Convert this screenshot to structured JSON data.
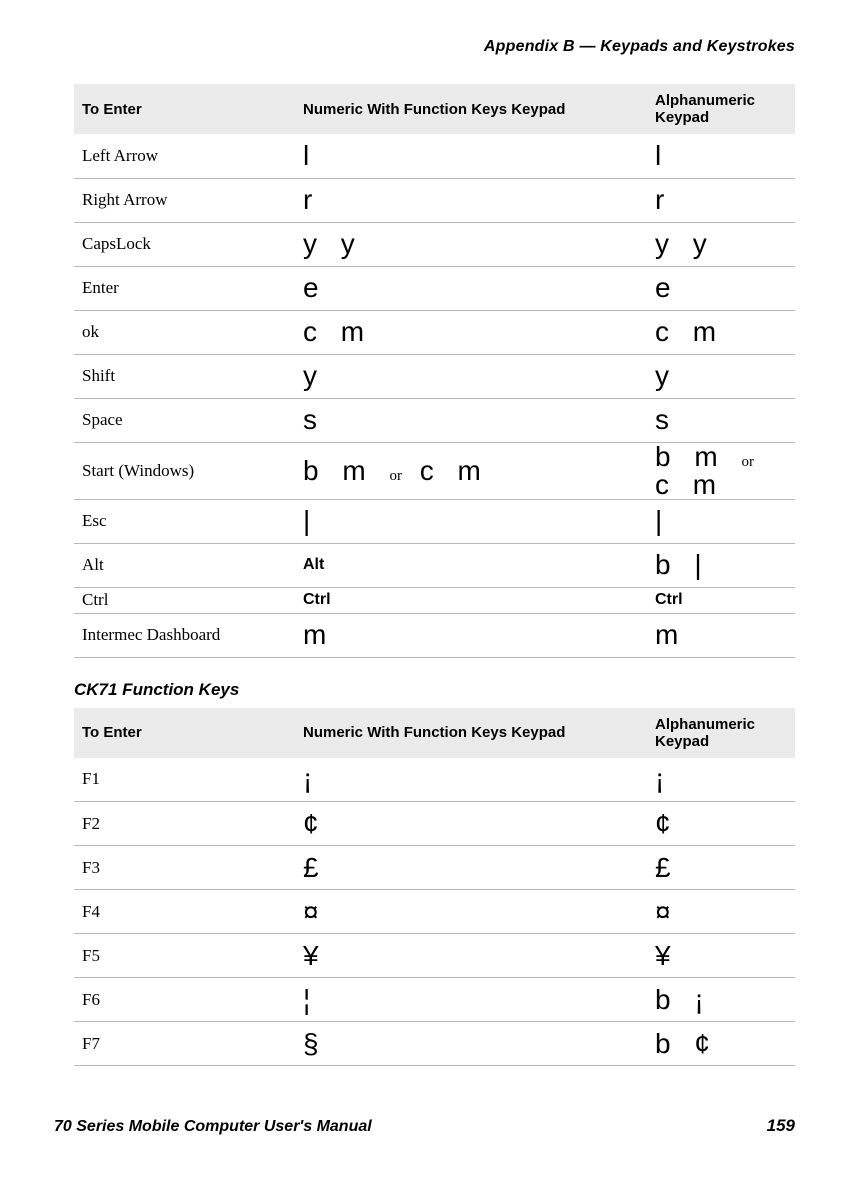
{
  "running_head": "Appendix B — Keypads and Keystrokes",
  "table1": {
    "headers": [
      "To Enter",
      "Numeric With Function Keys Keypad",
      "Alphanumeric Keypad"
    ],
    "rows": [
      {
        "label": "Left Arrow",
        "num": "l",
        "alpha": "l"
      },
      {
        "label": "Right Arrow",
        "num": "r",
        "alpha": "r"
      },
      {
        "label": "CapsLock",
        "num": "y y",
        "alpha": "y y"
      },
      {
        "label": "Enter",
        "num": "e",
        "alpha": "e"
      },
      {
        "label": "ok",
        "num": "c m",
        "alpha": "c m"
      },
      {
        "label": "Shift",
        "num": "y",
        "alpha": "y"
      },
      {
        "label": "Space",
        "num": "s",
        "alpha": "s"
      },
      {
        "label": "Start (Windows)",
        "num_html": "b m <span class=\"small-or\">or</span> c m",
        "alpha_html": "b m <span class=\"small-or\">or</span> c m"
      },
      {
        "label": "Esc",
        "num": "|",
        "alpha": "|"
      },
      {
        "label": "Alt",
        "num_bold": "Alt",
        "alpha": "b |"
      },
      {
        "label": "Ctrl",
        "num_bold": "Ctrl",
        "alpha_bold": "Ctrl",
        "tight": true
      },
      {
        "label": "Intermec Dashboard",
        "num": "m",
        "alpha": "m"
      }
    ]
  },
  "section2_title": "CK71 Function Keys",
  "table2": {
    "headers": [
      "To Enter",
      "Numeric With Function Keys Keypad",
      "Alphanumeric Keypad"
    ],
    "rows": [
      {
        "label": "F1",
        "num": "¡",
        "alpha": "¡"
      },
      {
        "label": "F2",
        "num": "¢",
        "alpha": "¢"
      },
      {
        "label": "F3",
        "num": "£",
        "alpha": "£"
      },
      {
        "label": "F4",
        "num": "¤",
        "alpha": "¤"
      },
      {
        "label": "F5",
        "num": "¥",
        "alpha": "¥"
      },
      {
        "label": " F6",
        "num": "¦",
        "alpha": "b ¡"
      },
      {
        "label": "F7",
        "num": "§",
        "alpha": "b ¢"
      }
    ]
  },
  "footer_left": "70 Series Mobile Computer User's Manual",
  "footer_right": "159"
}
